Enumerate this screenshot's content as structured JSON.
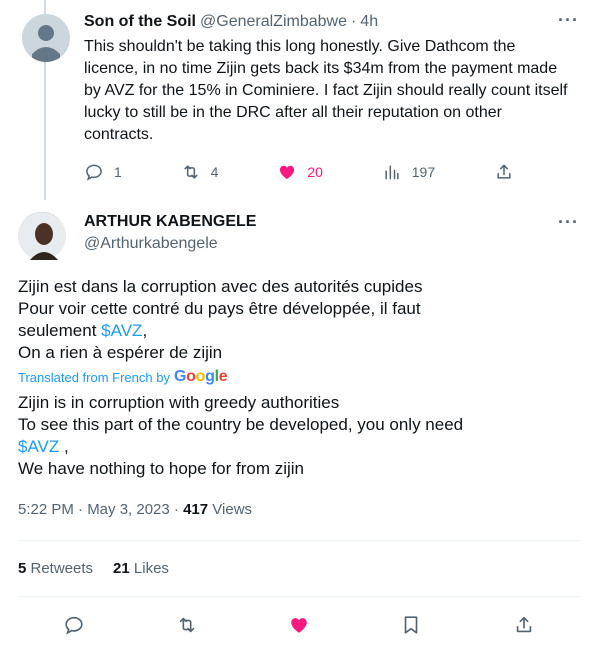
{
  "reply_tweet": {
    "name": "Son of the Soil",
    "handle": "@GeneralZimbabwe",
    "separator": "·",
    "time": "4h",
    "text": "This shouldn't be taking this long honestly.  Give Dathcom the licence, in no time Zijin gets back its $34m from the payment made by AVZ for the 15% in Cominiere. I fact Zijin should really count itself lucky to still be in the DRC after all their reputation on other contracts.",
    "replies": "1",
    "retweets": "4",
    "likes": "20",
    "views": "197",
    "liked": true,
    "more_label": "···"
  },
  "main_tweet": {
    "name": "ARTHUR KABENGELE",
    "handle": "@Arthurkabengele",
    "more_label": "···",
    "original": {
      "line1": "Zijin est dans la corruption avec des autorités cupides",
      "line2": "Pour voir cette contré du pays être développée,  il faut",
      "line3_prefix": "seulement ",
      "line3_cashtag": "$AVZ",
      "line3_suffix": ",",
      "line4": "On a rien à espérer de zijin"
    },
    "translated_label": "Translated from French by",
    "google_logo": {
      "letters": [
        "G",
        "o",
        "o",
        "g",
        "l",
        "e"
      ],
      "colors": [
        "#4285f4",
        "#ea4335",
        "#fbbc05",
        "#4285f4",
        "#34a853",
        "#ea4335"
      ]
    },
    "translation": {
      "line1": "Zijin is in corruption with greedy authorities",
      "line2": "To see this part of the country be developed, you only need",
      "line3_cashtag": "$AVZ",
      "line3_suffix": " ,",
      "line4": "We have nothing to hope for from zijin"
    },
    "timestamp": "5:22 PM · May 3, 2023",
    "meta_separator": " · ",
    "views_count": "417",
    "views_label": " Views",
    "retweets_count": "5",
    "retweets_label": " Retweets",
    "likes_count": "21",
    "likes_label": " Likes"
  },
  "colors": {
    "accent": "#1d9bf0",
    "like": "#f91880",
    "muted": "#536471",
    "text": "#0f1419"
  }
}
